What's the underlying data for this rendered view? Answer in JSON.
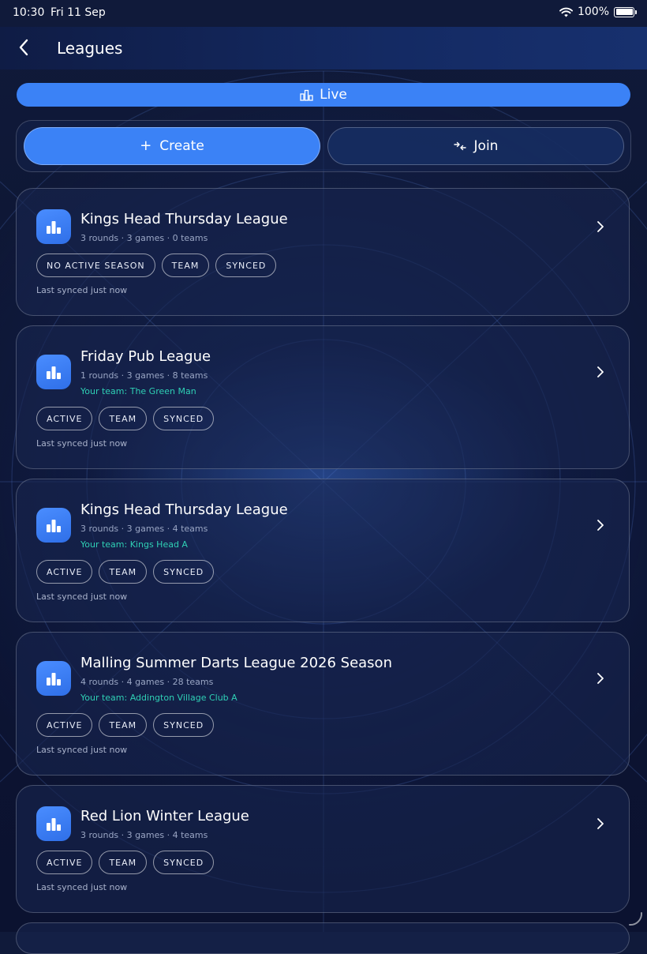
{
  "status_bar": {
    "time": "10:30",
    "date": "Fri 11 Sep",
    "battery": "100%"
  },
  "header": {
    "title": "Leagues"
  },
  "live_button": {
    "label": "Live"
  },
  "actions": {
    "create_label": "Create",
    "join_label": "Join"
  },
  "leagues": [
    {
      "name": "Kings Head Thursday League",
      "meta": "3 rounds · 3 games · 0 teams",
      "team": "",
      "chips": [
        "NO ACTIVE SEASON",
        "TEAM",
        "SYNCED"
      ],
      "synced": "Last synced just now"
    },
    {
      "name": "Friday Pub League",
      "meta": "1 rounds · 3 games · 8 teams",
      "team": "Your team: The Green Man",
      "chips": [
        "ACTIVE",
        "TEAM",
        "SYNCED"
      ],
      "synced": "Last synced just now"
    },
    {
      "name": "Kings Head Thursday League",
      "meta": "3 rounds · 3 games · 4 teams",
      "team": "Your team: Kings Head A",
      "chips": [
        "ACTIVE",
        "TEAM",
        "SYNCED"
      ],
      "synced": "Last synced just now"
    },
    {
      "name": "Malling Summer Darts League 2026 Season",
      "meta": "4 rounds · 4 games · 28 teams",
      "team": "Your team: Addington Village Club A",
      "chips": [
        "ACTIVE",
        "TEAM",
        "SYNCED"
      ],
      "synced": "Last synced just now"
    },
    {
      "name": "Red Lion Winter League",
      "meta": "3 rounds · 3 games · 4 teams",
      "team": "",
      "chips": [
        "ACTIVE",
        "TEAM",
        "SYNCED"
      ],
      "synced": "Last synced just now"
    }
  ],
  "colors": {
    "accent": "#3b82f6",
    "team_text": "#2fd0b5",
    "background": "#0d1533"
  }
}
